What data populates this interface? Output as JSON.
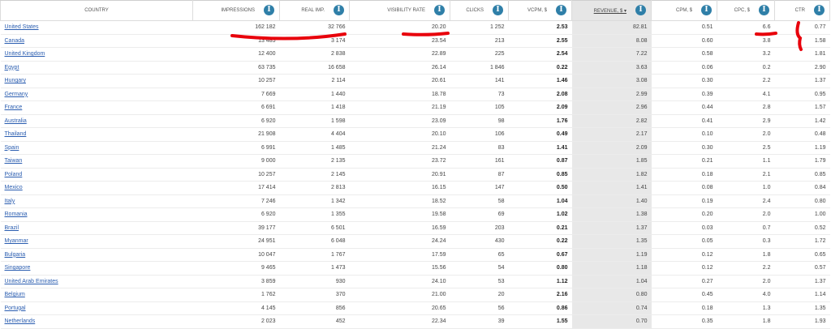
{
  "table": {
    "headers": {
      "country": "COUNTRY",
      "impressions": "IMPRESSIONS",
      "real_imp": "REAL IMP.",
      "visibility_rate": "VISIBILITY RATE",
      "clicks": "CLICKS",
      "vcpm": "vCPM, $",
      "revenue": "REVENUE, $ ▾",
      "cpm": "CPM, $",
      "cpc": "CPC, $",
      "ctr": "CTR"
    },
    "sorted_column": "revenue",
    "rows": [
      {
        "country": "United States",
        "impressions": "162 182",
        "real_imp": "32 766",
        "visibility_rate": "20.20",
        "clicks": "1 252",
        "vcpm": "2.53",
        "revenue": "82.81",
        "cpm": "0.51",
        "cpc": "6.6",
        "ctr": "0.77"
      },
      {
        "country": "Canada",
        "impressions": "13 485",
        "real_imp": "3 174",
        "visibility_rate": "23.54",
        "clicks": "213",
        "vcpm": "2.55",
        "revenue": "8.08",
        "cpm": "0.60",
        "cpc": "3.8",
        "ctr": "1.58"
      },
      {
        "country": "United Kingdom",
        "impressions": "12 400",
        "real_imp": "2 838",
        "visibility_rate": "22.89",
        "clicks": "225",
        "vcpm": "2.54",
        "revenue": "7.22",
        "cpm": "0.58",
        "cpc": "3.2",
        "ctr": "1.81"
      },
      {
        "country": "Egypt",
        "impressions": "63 735",
        "real_imp": "16 658",
        "visibility_rate": "26.14",
        "clicks": "1 846",
        "vcpm": "0.22",
        "revenue": "3.63",
        "cpm": "0.06",
        "cpc": "0.2",
        "ctr": "2.90"
      },
      {
        "country": "Hungary",
        "impressions": "10 257",
        "real_imp": "2 114",
        "visibility_rate": "20.61",
        "clicks": "141",
        "vcpm": "1.46",
        "revenue": "3.08",
        "cpm": "0.30",
        "cpc": "2.2",
        "ctr": "1.37"
      },
      {
        "country": "Germany",
        "impressions": "7 669",
        "real_imp": "1 440",
        "visibility_rate": "18.78",
        "clicks": "73",
        "vcpm": "2.08",
        "revenue": "2.99",
        "cpm": "0.39",
        "cpc": "4.1",
        "ctr": "0.95"
      },
      {
        "country": "France",
        "impressions": "6 691",
        "real_imp": "1 418",
        "visibility_rate": "21.19",
        "clicks": "105",
        "vcpm": "2.09",
        "revenue": "2.96",
        "cpm": "0.44",
        "cpc": "2.8",
        "ctr": "1.57"
      },
      {
        "country": "Australia",
        "impressions": "6 920",
        "real_imp": "1 598",
        "visibility_rate": "23.09",
        "clicks": "98",
        "vcpm": "1.76",
        "revenue": "2.82",
        "cpm": "0.41",
        "cpc": "2.9",
        "ctr": "1.42"
      },
      {
        "country": "Thailand",
        "impressions": "21 908",
        "real_imp": "4 404",
        "visibility_rate": "20.10",
        "clicks": "106",
        "vcpm": "0.49",
        "revenue": "2.17",
        "cpm": "0.10",
        "cpc": "2.0",
        "ctr": "0.48"
      },
      {
        "country": "Spain",
        "impressions": "6 991",
        "real_imp": "1 485",
        "visibility_rate": "21.24",
        "clicks": "83",
        "vcpm": "1.41",
        "revenue": "2.09",
        "cpm": "0.30",
        "cpc": "2.5",
        "ctr": "1.19"
      },
      {
        "country": "Taiwan",
        "impressions": "9 000",
        "real_imp": "2 135",
        "visibility_rate": "23.72",
        "clicks": "161",
        "vcpm": "0.87",
        "revenue": "1.85",
        "cpm": "0.21",
        "cpc": "1.1",
        "ctr": "1.79"
      },
      {
        "country": "Poland",
        "impressions": "10 257",
        "real_imp": "2 145",
        "visibility_rate": "20.91",
        "clicks": "87",
        "vcpm": "0.85",
        "revenue": "1.82",
        "cpm": "0.18",
        "cpc": "2.1",
        "ctr": "0.85"
      },
      {
        "country": "Mexico",
        "impressions": "17 414",
        "real_imp": "2 813",
        "visibility_rate": "16.15",
        "clicks": "147",
        "vcpm": "0.50",
        "revenue": "1.41",
        "cpm": "0.08",
        "cpc": "1.0",
        "ctr": "0.84"
      },
      {
        "country": "Italy",
        "impressions": "7 246",
        "real_imp": "1 342",
        "visibility_rate": "18.52",
        "clicks": "58",
        "vcpm": "1.04",
        "revenue": "1.40",
        "cpm": "0.19",
        "cpc": "2.4",
        "ctr": "0.80"
      },
      {
        "country": "Romania",
        "impressions": "6 920",
        "real_imp": "1 355",
        "visibility_rate": "19.58",
        "clicks": "69",
        "vcpm": "1.02",
        "revenue": "1.38",
        "cpm": "0.20",
        "cpc": "2.0",
        "ctr": "1.00"
      },
      {
        "country": "Brazil",
        "impressions": "39 177",
        "real_imp": "6 501",
        "visibility_rate": "16.59",
        "clicks": "203",
        "vcpm": "0.21",
        "revenue": "1.37",
        "cpm": "0.03",
        "cpc": "0.7",
        "ctr": "0.52"
      },
      {
        "country": "Myanmar",
        "impressions": "24 951",
        "real_imp": "6 048",
        "visibility_rate": "24.24",
        "clicks": "430",
        "vcpm": "0.22",
        "revenue": "1.35",
        "cpm": "0.05",
        "cpc": "0.3",
        "ctr": "1.72"
      },
      {
        "country": "Bulgaria",
        "impressions": "10 047",
        "real_imp": "1 767",
        "visibility_rate": "17.59",
        "clicks": "65",
        "vcpm": "0.67",
        "revenue": "1.19",
        "cpm": "0.12",
        "cpc": "1.8",
        "ctr": "0.65"
      },
      {
        "country": "Singapore",
        "impressions": "9 465",
        "real_imp": "1 473",
        "visibility_rate": "15.56",
        "clicks": "54",
        "vcpm": "0.80",
        "revenue": "1.18",
        "cpm": "0.12",
        "cpc": "2.2",
        "ctr": "0.57"
      },
      {
        "country": "United Arab Emirates",
        "impressions": "3 859",
        "real_imp": "930",
        "visibility_rate": "24.10",
        "clicks": "53",
        "vcpm": "1.12",
        "revenue": "1.04",
        "cpm": "0.27",
        "cpc": "2.0",
        "ctr": "1.37"
      },
      {
        "country": "Belgium",
        "impressions": "1 762",
        "real_imp": "370",
        "visibility_rate": "21.00",
        "clicks": "20",
        "vcpm": "2.16",
        "revenue": "0.80",
        "cpm": "0.45",
        "cpc": "4.0",
        "ctr": "1.14"
      },
      {
        "country": "Portugal",
        "impressions": "4 145",
        "real_imp": "856",
        "visibility_rate": "20.65",
        "clicks": "56",
        "vcpm": "0.86",
        "revenue": "0.74",
        "cpm": "0.18",
        "cpc": "1.3",
        "ctr": "1.35"
      },
      {
        "country": "Netherlands",
        "impressions": "2 023",
        "real_imp": "452",
        "visibility_rate": "22.34",
        "clicks": "39",
        "vcpm": "1.55",
        "revenue": "0.70",
        "cpm": "0.35",
        "cpc": "1.8",
        "ctr": "1.93"
      }
    ]
  },
  "colors": {
    "info_icon": "#2f7fa8",
    "link": "#2a5db0",
    "revenue_column_bg": "#e8e8e8",
    "annotation_marks": "#e8000b"
  },
  "icons": {
    "header_info": "info-icon"
  },
  "annotations": [
    {
      "name": "hand-drawn-underline-impressions",
      "color": "#e8000b"
    },
    {
      "name": "hand-drawn-underline-visibility",
      "color": "#e8000b"
    },
    {
      "name": "hand-drawn-underline-cpc",
      "color": "#e8000b"
    },
    {
      "name": "hand-drawn-bracket-ctr",
      "color": "#e8000b"
    }
  ]
}
